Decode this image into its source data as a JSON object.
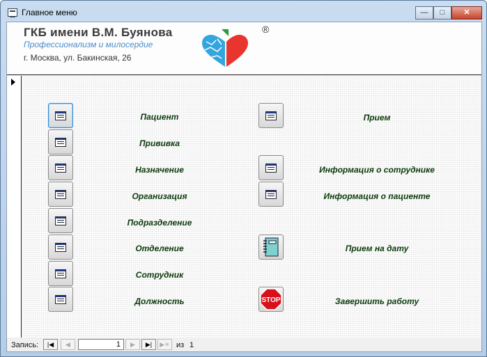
{
  "window": {
    "title": "Главное меню",
    "minimize": "—",
    "maximize": "□",
    "close": "✕"
  },
  "header": {
    "org_name": "ГКБ имени В.М. Буянова",
    "slogan": "Профессионализм и милосердие",
    "address": "г. Москва, ул. Бакинская, 26",
    "registered_mark": "®"
  },
  "menu_left": [
    {
      "label": "Пациент",
      "icon": "form-icon"
    },
    {
      "label": "Прививка",
      "icon": "form-icon"
    },
    {
      "label": "Назначение",
      "icon": "form-icon"
    },
    {
      "label": "Организация",
      "icon": "form-icon"
    },
    {
      "label": "Подразделение",
      "icon": "form-icon"
    },
    {
      "label": "Отделение",
      "icon": "form-icon"
    },
    {
      "label": "Сотрудник",
      "icon": "form-icon"
    },
    {
      "label": "Должность",
      "icon": "form-icon"
    }
  ],
  "menu_right": [
    {
      "label": "Прием",
      "icon": "form-icon"
    },
    {
      "label": "Информация о сотруднике",
      "icon": "form-icon"
    },
    {
      "label": "Информация о пациенте",
      "icon": "form-icon"
    },
    {
      "label": "Прием на дату",
      "icon": "notebook-icon"
    },
    {
      "label": "Завершить работу",
      "icon": "stop-icon",
      "icon_text": "STOP"
    }
  ],
  "navigator": {
    "label": "Запись:",
    "current": "1",
    "of_label": "из",
    "total": "1"
  }
}
